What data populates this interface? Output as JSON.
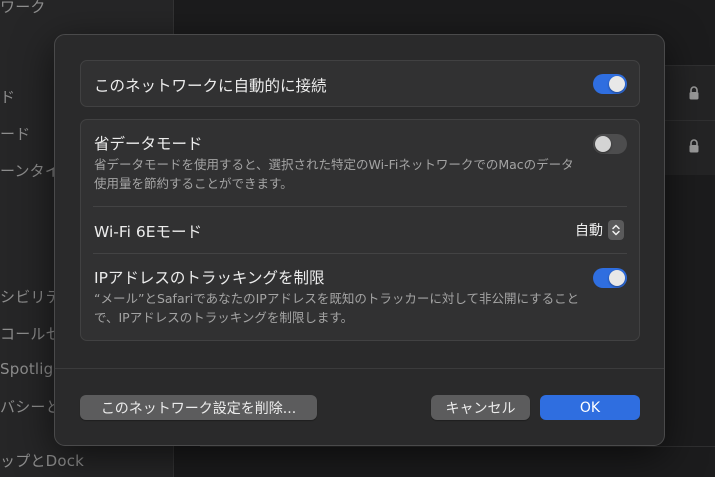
{
  "background": {
    "sidebar_items": [
      "ワーク",
      "ド",
      "ード",
      "ーンタイ",
      "シビリテ",
      "コールセ",
      "Spotligh",
      "バシーと",
      "ップとDock"
    ]
  },
  "dialog": {
    "auto_join": {
      "label": "このネットワークに自動的に接続",
      "enabled": true
    },
    "low_data_mode": {
      "label": "省データモード",
      "description": "省データモードを使用すると、選択された特定のWi-FiネットワークでのMacのデータ使用量を節約することができます。",
      "enabled": false
    },
    "wifi_6e_mode": {
      "label": "Wi-Fi 6Eモード",
      "value": "自動"
    },
    "limit_ip_tracking": {
      "label": "IPアドレスのトラッキングを制限",
      "description": "“メール”とSafariであなたのIPアドレスを既知のトラッカーに対して非公開にすることで、IPアドレスのトラッキングを制限します。",
      "enabled": true
    },
    "buttons": {
      "delete": "このネットワーク設定を削除...",
      "cancel": "キャンセル",
      "ok": "OK"
    }
  },
  "colors": {
    "accent": "#2f6ee0",
    "dialog_bg": "#2a2a2b",
    "group_bg": "#313132"
  }
}
